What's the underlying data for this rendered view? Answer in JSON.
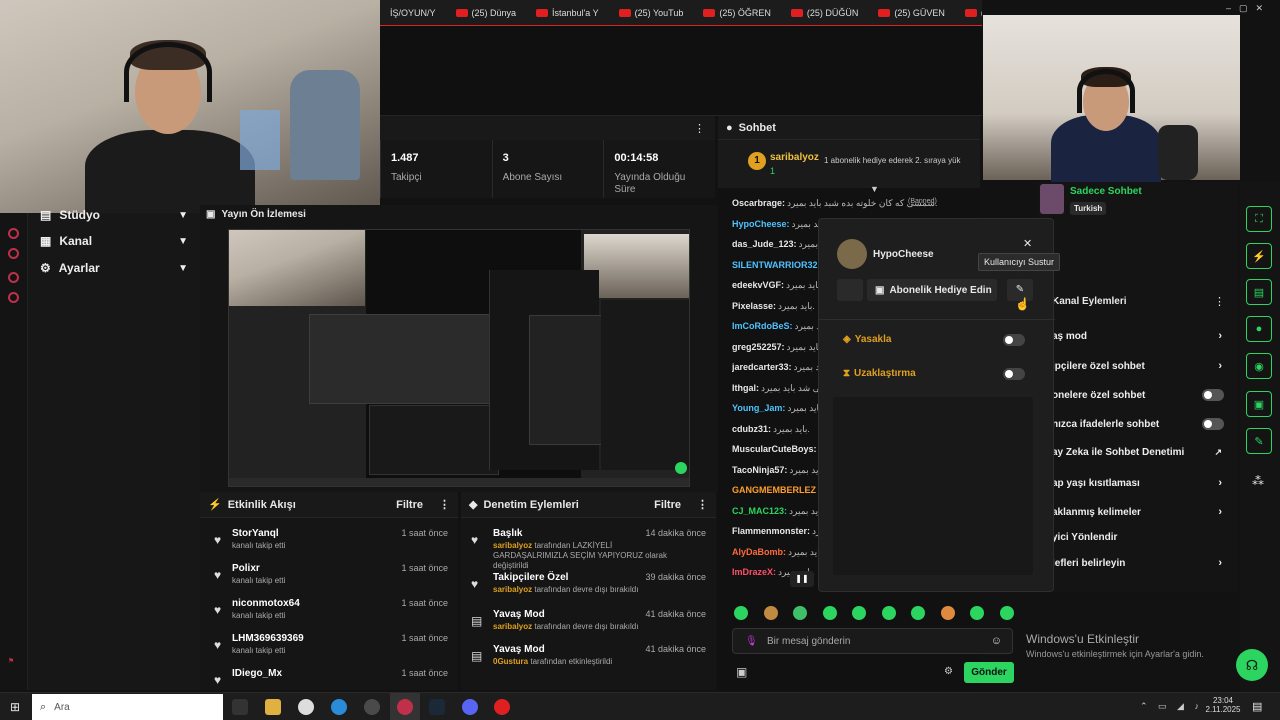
{
  "browser_tabs": [
    "İŞ/OYUN/Y",
    "(25) Dünya",
    "İstanbul'a Y",
    "(25) YouTub",
    "(25) ÖĞREN",
    "(25) DÜĞÜN",
    "(25) GÜVEN",
    "(25) Pakista"
  ],
  "sidebar": {
    "studio_label": "Stüdyo",
    "items": [
      {
        "label": "Kanal",
        "icon": "home-icon"
      },
      {
        "label": "Ayarlar",
        "icon": "gear-icon"
      }
    ]
  },
  "stats": [
    {
      "value": "1.487",
      "label": "Takipçi"
    },
    {
      "value": "3",
      "label": "Abone Sayısı"
    },
    {
      "value": "00:14:58",
      "label": "Yayında Olduğu Süre"
    }
  ],
  "preview": {
    "title": "Yayın Ön İzlemesi"
  },
  "activity_feed": {
    "title": "Etkinlik Akışı",
    "filter_label": "Filtre",
    "items": [
      {
        "name": "StorYanql",
        "sub": "kanalı takip etti",
        "time": "1 saat önce"
      },
      {
        "name": "Polixr",
        "sub": "kanalı takip etti",
        "time": "1 saat önce"
      },
      {
        "name": "niconmotox64",
        "sub": "kanalı takip etti",
        "time": "1 saat önce"
      },
      {
        "name": "LHM369639369",
        "sub": "kanalı takip etti",
        "time": "1 saat önce"
      },
      {
        "name": "IDiego_Mx",
        "sub": "",
        "time": "1 saat önce"
      }
    ]
  },
  "moderation": {
    "title": "Denetim Eylemleri",
    "filter_label": "Filtre",
    "items": [
      {
        "name": "Başlık",
        "actor": "saribalyoz",
        "sub": "tarafından LAZKİYELİ GARDAŞALRIMIZLA SEÇİM YAPIYORUZ olarak değiştirildi",
        "time": "14 dakika önce"
      },
      {
        "name": "Takipçilere Özel",
        "actor": "saribalyoz",
        "sub": "tarafından devre dışı bırakıldı",
        "time": "39 dakika önce"
      },
      {
        "name": "Yavaş Mod",
        "actor": "saribalyoz",
        "sub": "tarafından devre dışı bırakıldı",
        "time": "41 dakika önce"
      },
      {
        "name": "Yavaş Mod",
        "actor": "0Gustura",
        "sub": "tarafından etkinleştirildi",
        "time": "41 dakika önce"
      }
    ]
  },
  "chat": {
    "title": "Sohbet",
    "pinned": {
      "user": "saribalyoz",
      "count": "1",
      "message": "1 abonelik hediye ederek 2. sıraya yük"
    },
    "banned_label": "(Banned)",
    "lines": [
      {
        "user": "Oscarbrage:",
        "msg": "شمسی که کان خلوته بده شبد باید بمیرد.",
        "color": "#e8e8e8"
      },
      {
        "user": "HypoCheese:",
        "msg": "بلید بمیرد.",
        "color": "#4ec3ff"
      },
      {
        "user": "das_Jude_123:",
        "msg": "باید بمیرد.",
        "color": "#e8e8e8"
      },
      {
        "user": "SILENTWARRIOR32",
        "msg": "",
        "color": "#4ec3ff"
      },
      {
        "user": "edeekvVGF:",
        "msg": "باید بمیرد.",
        "color": "#e8e8e8"
      },
      {
        "user": "Pixelasse:",
        "msg": "باید بمیرد.",
        "color": "#e8e8e8"
      },
      {
        "user": "ImCoRdoBeS:",
        "msg": "باید بمیرد.",
        "color": "#4ec3ff"
      },
      {
        "user": "greg252257:",
        "msg": "باید بمیرد.",
        "color": "#e8e8e8"
      },
      {
        "user": "jaredcarter33:",
        "msg": "باید بمیرد.",
        "color": "#e8e8e8"
      },
      {
        "user": "Ithgal:",
        "msg": "می شد باید بمیرد.",
        "color": "#e8e8e8"
      },
      {
        "user": "Young_Jam:",
        "msg": "باید بمیرد.",
        "color": "#4ec3ff"
      },
      {
        "user": "cdubz31:",
        "msg": "باید بمیرد.",
        "color": "#e8e8e8"
      },
      {
        "user": "MuscularCuteBoys:",
        "msg": "",
        "color": "#e8e8e8"
      },
      {
        "user": "TacoNinja57:",
        "msg": "باید بمیرد.",
        "color": "#e8e8e8"
      },
      {
        "user": "GANGMEMBERLEZ",
        "msg": "",
        "color": "#ff9e2c"
      },
      {
        "user": "CJ_MAC123:",
        "msg": "باید بمیرد.",
        "color": "#2bd55f"
      },
      {
        "user": "Flammenmonster:",
        "msg": "باید بمیرد.",
        "color": "#e8e8e8"
      },
      {
        "user": "AlyDaBomb:",
        "msg": "باید بمیرد.",
        "color": "#ff6a3d"
      },
      {
        "user": "ImDrazeX:",
        "msg": "باید بمیرد.",
        "color": "#ff4f6a"
      }
    ],
    "input_placeholder": "Bir mesaj gönderin",
    "send_label": "Gönder"
  },
  "user_popup": {
    "username": "HypoCheese",
    "gift_label": "Abonelik Hediye Edin",
    "tooltip": "Kullanıcıyı Sustur",
    "ban_label": "Yasakla",
    "timeout_label": "Uzaklaştırma"
  },
  "right_panel": {
    "mode_label": "Sadece Sohbet",
    "lang_badge": "Turkish",
    "section_title": "Kanal Eylemleri",
    "items": [
      {
        "label": "aş mod",
        "control": "chevron"
      },
      {
        "label": "ipçilere özel sohbet",
        "control": "chevron"
      },
      {
        "label": "onelere özel sohbet",
        "control": "toggle"
      },
      {
        "label": "nızca ifadelerle sohbet",
        "control": "toggle"
      },
      {
        "label": "ay Zeka ile Sohbet Denetimi",
        "control": "external"
      },
      {
        "label": "ap yaşı kısıtlaması",
        "control": "chevron"
      },
      {
        "label": "aklanmış kelimeler",
        "control": "chevron"
      },
      {
        "label": "yici Yönlendir",
        "control": "none"
      },
      {
        "label": "lefleri belirleyin",
        "control": "chevron"
      }
    ]
  },
  "windows": {
    "activate_title": "Windows'u Etkinleştir",
    "activate_sub": "Windows'u etkinleştirmek için Ayarlar'a gidin.",
    "search_placeholder": "Ara",
    "time": "23:04",
    "date": "2.11.2025"
  },
  "colors": {
    "accent": "#2bd55f",
    "brand_red": "#e02020",
    "link_blue": "#4ec3ff"
  }
}
